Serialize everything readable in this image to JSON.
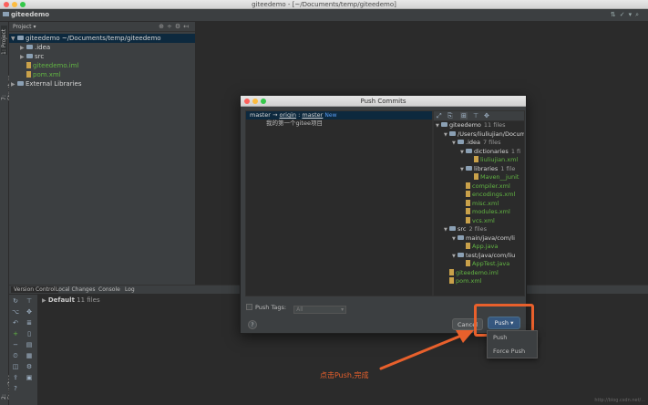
{
  "window": {
    "title": "giteedemo - [~/Documents/temp/giteedemo]"
  },
  "toolbar": {
    "project_name": "giteedemo"
  },
  "left_stripe": {
    "project_tab": "1: Project",
    "structure_tab": "7: Structure",
    "favorites_tab": "2: Favorites"
  },
  "project_panel": {
    "header": "Project",
    "tree": [
      {
        "label": "giteedemo  ~/Documents/temp/giteedemo",
        "indent": 0,
        "kind": "folder",
        "expanded": true,
        "selected": true
      },
      {
        "label": ".idea",
        "indent": 1,
        "kind": "folder",
        "expanded": false
      },
      {
        "label": "src",
        "indent": 1,
        "kind": "folder",
        "expanded": false
      },
      {
        "label": "giteedemo.iml",
        "indent": 1,
        "kind": "file",
        "color": "green"
      },
      {
        "label": "pom.xml",
        "indent": 1,
        "kind": "file",
        "color": "green"
      },
      {
        "label": "External Libraries",
        "indent": 0,
        "kind": "folder",
        "expanded": false
      }
    ]
  },
  "bottom_panel": {
    "tabs": [
      "Version Control",
      "Local Changes",
      "Console",
      "Log"
    ],
    "default_row": "Default",
    "default_count": "11 files"
  },
  "dialog": {
    "title": "Push Commits",
    "push_target": {
      "branch": "master",
      "arrow": "→",
      "remote": "origin",
      "sep": ":",
      "remote_branch": "master",
      "badge": "New"
    },
    "commit_message": "我的第一个gitee项目",
    "files_tree": [
      {
        "label": "giteedemo",
        "count": "11 files",
        "indent": 0,
        "kind": "folder"
      },
      {
        "label": "/Users/liuliujian/Docum",
        "indent": 1,
        "kind": "folder"
      },
      {
        "label": ".idea",
        "count": "7 files",
        "indent": 2,
        "kind": "folder"
      },
      {
        "label": "dictionaries",
        "count": "1 fi",
        "indent": 3,
        "kind": "folder"
      },
      {
        "label": "liuliujian.xml",
        "indent": 4,
        "kind": "file"
      },
      {
        "label": "libraries",
        "count": "1 file",
        "indent": 3,
        "kind": "folder"
      },
      {
        "label": "Maven__junit",
        "indent": 4,
        "kind": "file"
      },
      {
        "label": "compiler.xml",
        "indent": 3,
        "kind": "file"
      },
      {
        "label": "encodings.xml",
        "indent": 3,
        "kind": "file"
      },
      {
        "label": "misc.xml",
        "indent": 3,
        "kind": "file"
      },
      {
        "label": "modules.xml",
        "indent": 3,
        "kind": "file"
      },
      {
        "label": "vcs.xml",
        "indent": 3,
        "kind": "file"
      },
      {
        "label": "src",
        "count": "2 files",
        "indent": 1,
        "kind": "folder"
      },
      {
        "label": "main/java/com/li",
        "indent": 2,
        "kind": "folder"
      },
      {
        "label": "App.java",
        "indent": 3,
        "kind": "file"
      },
      {
        "label": "test/java/com/liu",
        "indent": 2,
        "kind": "folder"
      },
      {
        "label": "AppTest.java",
        "indent": 3,
        "kind": "file"
      },
      {
        "label": "giteedemo.iml",
        "indent": 1,
        "kind": "file"
      },
      {
        "label": "pom.xml",
        "indent": 1,
        "kind": "file"
      }
    ],
    "push_tags_label": "Push Tags:",
    "push_tags_value": "All",
    "help": "?",
    "cancel_label": "Cancel",
    "push_label": "Push ▾"
  },
  "push_menu": {
    "items": [
      "Push",
      "Force Push"
    ]
  },
  "annotation": {
    "text": "点击Push,完成"
  },
  "watermark": "http://blog.csdn.net/..."
}
